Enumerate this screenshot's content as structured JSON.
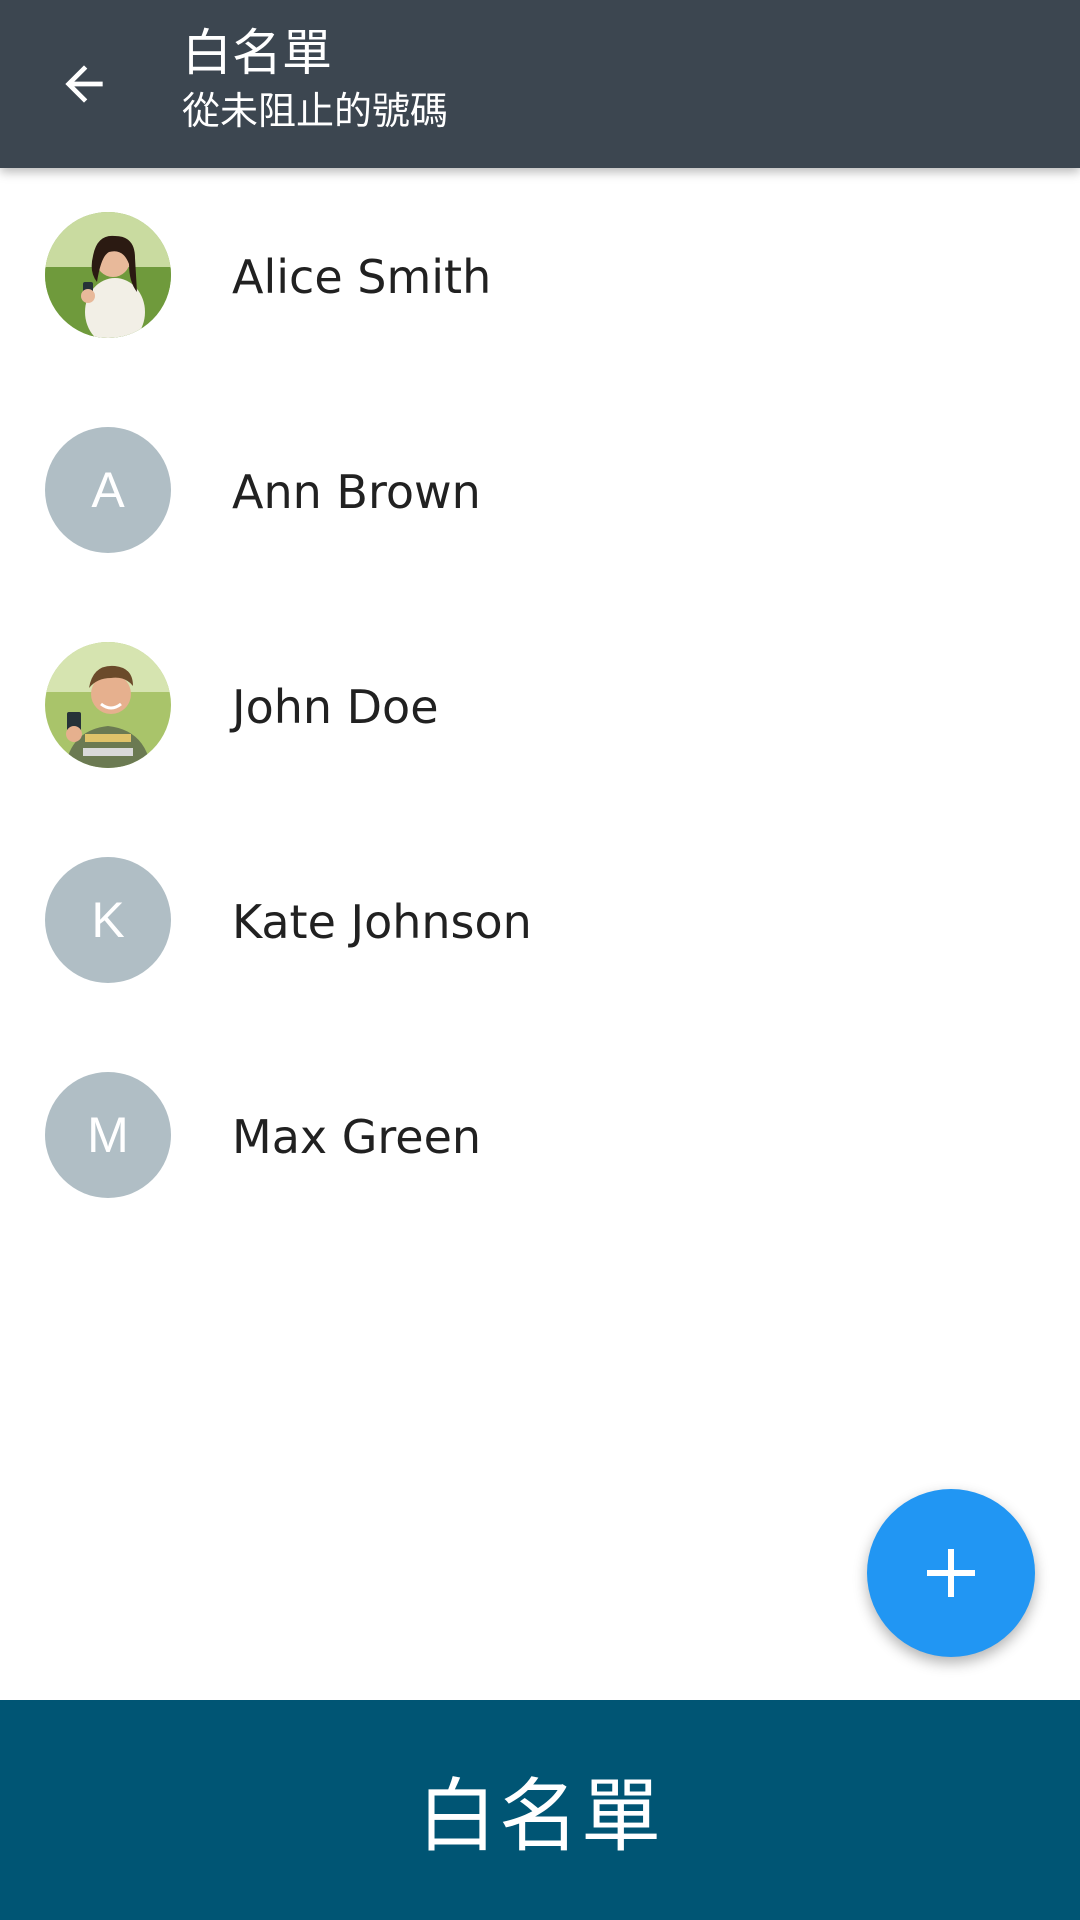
{
  "app_bar": {
    "title": "白名單",
    "subtitle": "從未阻止的號碼",
    "back_icon": "arrow-back-icon",
    "background": "#3c4650"
  },
  "contacts": [
    {
      "name": "Alice Smith",
      "avatar_type": "photo",
      "avatar_letter": ""
    },
    {
      "name": "Ann Brown",
      "avatar_type": "letter",
      "avatar_letter": "A"
    },
    {
      "name": "John Doe",
      "avatar_type": "photo",
      "avatar_letter": ""
    },
    {
      "name": "Kate Johnson",
      "avatar_type": "letter",
      "avatar_letter": "K"
    },
    {
      "name": "Max Green",
      "avatar_type": "letter",
      "avatar_letter": "M"
    }
  ],
  "fab": {
    "icon": "plus-icon",
    "color": "#2196f3"
  },
  "bottom_banner": {
    "label": "白名單",
    "background": "#005574"
  },
  "colors": {
    "letter_avatar_bg": "#b0bec5",
    "name_text": "#212121"
  }
}
